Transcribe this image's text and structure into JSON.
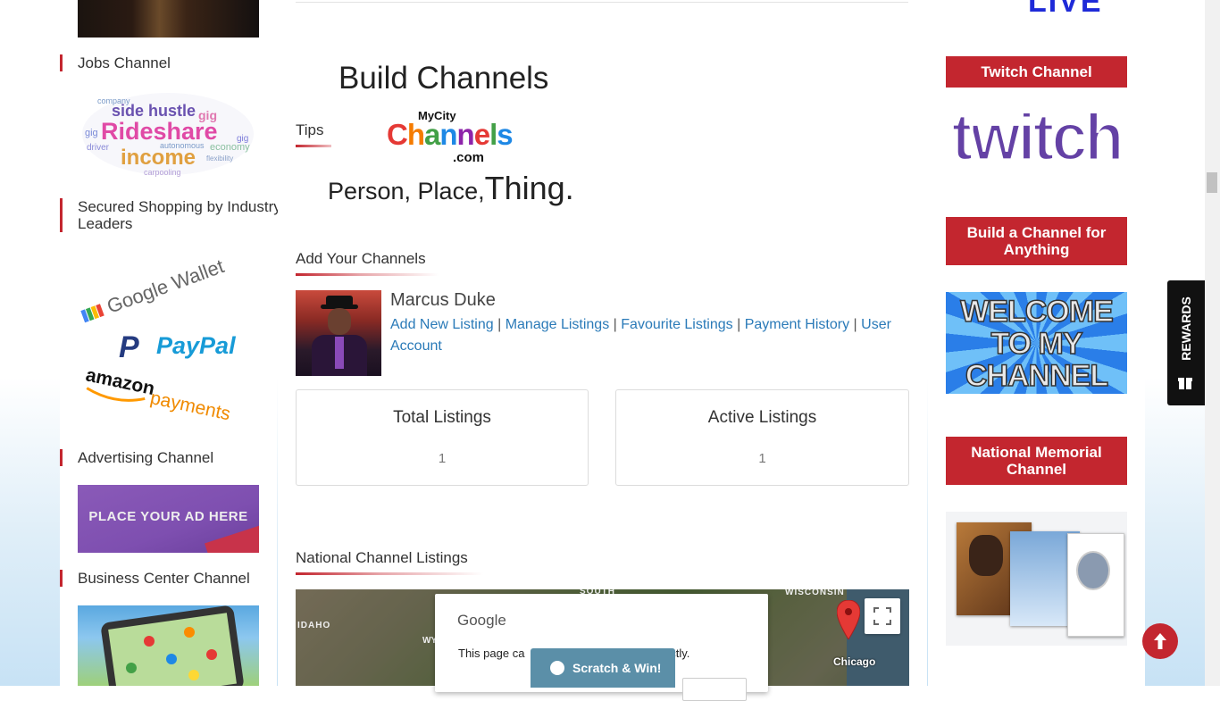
{
  "left_sidebar": {
    "jobs_title": "Jobs Channel",
    "jobs_words": [
      "side hustle",
      "Rideshare",
      "income",
      "gig",
      "driver",
      "economy",
      "flexibility",
      "carpooling",
      "autonomous",
      "company"
    ],
    "shopping_title": "Secured Shopping by Industry Leaders",
    "shopping_brands": [
      "Google Wallet",
      "PayPal",
      "amazon",
      "payments"
    ],
    "advertising_title": "Advertising Channel",
    "ad_text": "PLACE YOUR AD HERE",
    "business_title": "Business Center Channel"
  },
  "main": {
    "tips_label": "Tips",
    "banner": {
      "line1": "Build Channels",
      "mycity": "MyCity",
      "channels_letters": [
        "C",
        "h",
        "a",
        "n",
        "n",
        "e",
        "l",
        "s"
      ],
      "dotcom": ".com",
      "line3a": "Person, Place,",
      "line3b": "Thing."
    },
    "add_channels_title": "Add Your Channels",
    "user": {
      "name": "Marcus Duke",
      "links": [
        "Add New Listing",
        "Manage Listings",
        "Favourite Listings",
        "Payment History",
        "User Account"
      ],
      "separator": "|"
    },
    "stats": [
      {
        "label": "Total Listings",
        "value": "1"
      },
      {
        "label": "Active Listings",
        "value": "1"
      }
    ],
    "national_title": "National Channel Listings",
    "map": {
      "labels": {
        "idaho": "IDAHO",
        "wy": "WY",
        "south": "SOUTH",
        "wisconsin": "WISCONSIN",
        "chicago": "Chicago"
      },
      "dialog_brand": "Google",
      "dialog_text_a": "This page ca",
      "dialog_text_b": "ectly.",
      "scratch_label": "Scratch & Win!"
    }
  },
  "right_sidebar": {
    "live_text": "LIVE",
    "twitch_title": "Twitch Channel",
    "twitch_logo": "twitch",
    "build_title": "Build a Channel for Anything",
    "welcome_lines": [
      "WELCOME",
      "TO MY",
      "CHANNEL"
    ],
    "memorial_title": "National Memorial Channel"
  },
  "rewards_label": "REWARDS",
  "colors": {
    "accent": "#c3262f",
    "link": "#2a7ab8",
    "twitch": "#6441a5"
  }
}
